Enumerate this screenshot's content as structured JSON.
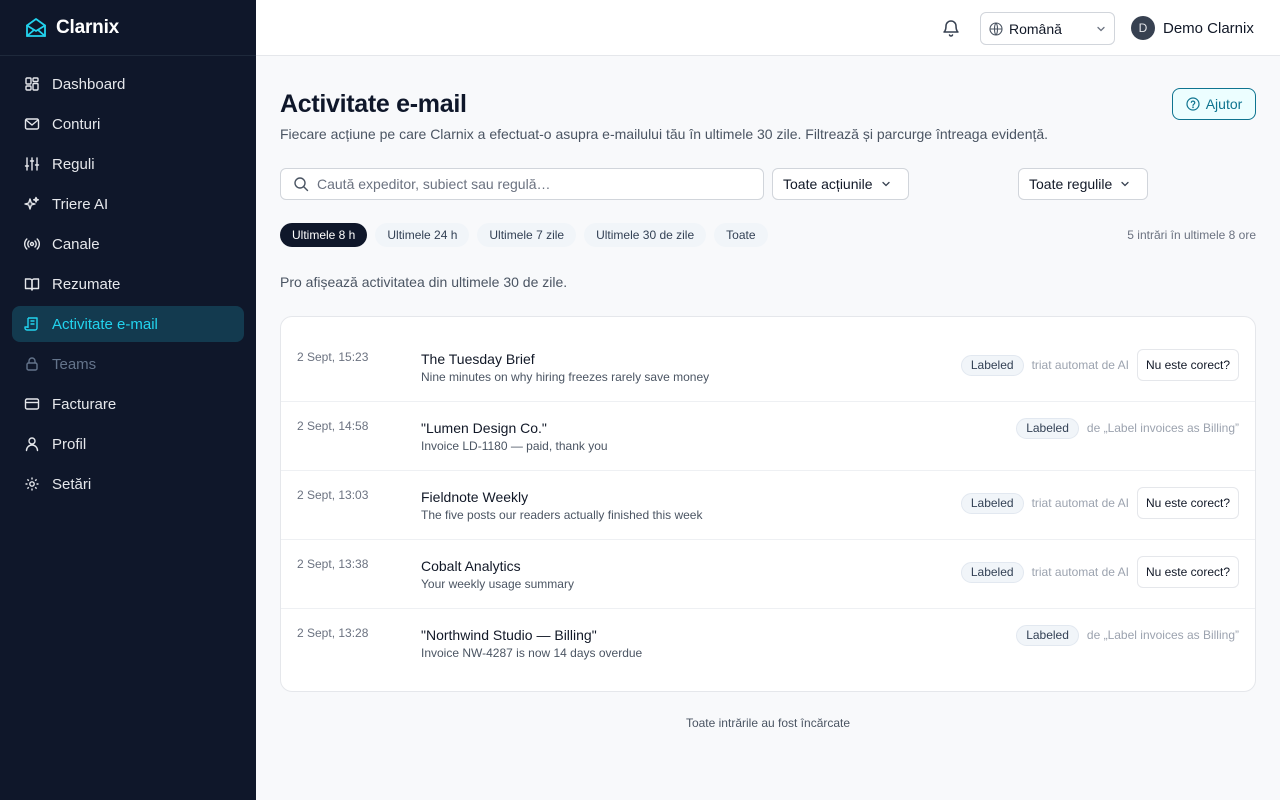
{
  "app": {
    "name": "Clarnix",
    "accent": "#22d3ee",
    "sidebar_bg": "#0f172a"
  },
  "sidebar": {
    "items": [
      {
        "label": "Dashboard",
        "icon": "dashboard-icon"
      },
      {
        "label": "Conturi",
        "icon": "mail-icon"
      },
      {
        "label": "Reguli",
        "icon": "sliders-icon"
      },
      {
        "label": "Triere AI",
        "icon": "sparkles-icon"
      },
      {
        "label": "Canale",
        "icon": "broadcast-icon"
      },
      {
        "label": "Rezumate",
        "icon": "book-open-icon"
      },
      {
        "label": "Activitate e-mail",
        "icon": "scroll-icon",
        "active": true
      },
      {
        "label": "Teams",
        "icon": "lock-icon",
        "disabled": true
      },
      {
        "label": "Facturare",
        "icon": "credit-card-icon"
      },
      {
        "label": "Profil",
        "icon": "user-icon"
      },
      {
        "label": "Setări",
        "icon": "gear-icon"
      }
    ]
  },
  "header": {
    "language": "Română",
    "user_initial": "D",
    "user_name": "Demo Clarnix"
  },
  "page": {
    "title": "Activitate e-mail",
    "subtitle": "Fiecare acțiune pe care Clarnix a efectuat-o asupra e-mailului tău în ultimele 30 zile. Filtrează și parcurge întreaga evidență.",
    "help_label": "Ajutor"
  },
  "filters": {
    "search_placeholder": "Caută expeditor, subiect sau regulă…",
    "actions_label": "Toate acțiunile",
    "rules_label": "Toate regulile",
    "time_chips": [
      {
        "label": "Ultimele 8 h",
        "active": true
      },
      {
        "label": "Ultimele 24 h"
      },
      {
        "label": "Ultimele 7 zile"
      },
      {
        "label": "Ultimele 30 de zile"
      },
      {
        "label": "Toate"
      }
    ],
    "entries_count": "5 intrări în ultimele 8 ore"
  },
  "info_text": "Pro afișează activitatea din ultimele 30 de zile.",
  "activity": [
    {
      "time": "2 Sept, 15:23",
      "sender": "The Tuesday Brief",
      "subject": "Nine minutes on why hiring freezes rarely save money",
      "badge": "Labeled",
      "meta": "triat automat de AI",
      "button": "Nu este corect?"
    },
    {
      "time": "2 Sept, 14:58",
      "sender": "\"Lumen Design Co.\"",
      "subject": "Invoice LD-1180 — paid, thank you",
      "badge": "Labeled",
      "meta": "de „Label invoices as Billing”"
    },
    {
      "time": "2 Sept, 13:03",
      "sender": "Fieldnote Weekly",
      "subject": "The five posts our readers actually finished this week",
      "badge": "Labeled",
      "meta": "triat automat de AI",
      "button": "Nu este corect?"
    },
    {
      "time": "2 Sept, 13:38",
      "sender": "Cobalt Analytics",
      "subject": "Your weekly usage summary",
      "badge": "Labeled",
      "meta": "triat automat de AI",
      "button": "Nu este corect?"
    },
    {
      "time": "2 Sept, 13:28",
      "sender": "\"Northwind Studio — Billing\"",
      "subject": "Invoice NW-4287 is now 14 days overdue",
      "badge": "Labeled",
      "meta": "de „Label invoices as Billing”"
    }
  ],
  "footer_note": "Toate intrările au fost încărcate"
}
